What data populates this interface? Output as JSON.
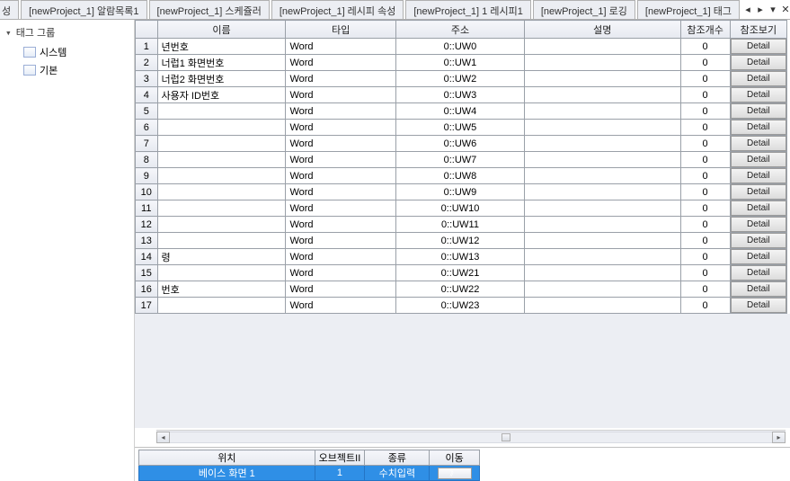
{
  "tabs": {
    "partial_left": "성",
    "items": [
      "[newProject_1] 알람목록1",
      "[newProject_1] 스케쥴러",
      "[newProject_1] 레시피 속성",
      "[newProject_1] 1 레시피1",
      "[newProject_1] 로깅",
      "[newProject_1] 태그"
    ],
    "nav_left": "◂",
    "nav_right": "▸",
    "nav_dropdown": "▾",
    "nav_close": "✕"
  },
  "tree": {
    "title": "태그 그룹",
    "items": [
      "시스템",
      "기본"
    ]
  },
  "grid": {
    "headers": {
      "name": "이름",
      "type": "타입",
      "addr": "주소",
      "desc": "설명",
      "refcnt": "참조개수",
      "refview": "참조보기"
    },
    "detail_label": "Detail",
    "rows": [
      {
        "num": "1",
        "name": "년번호",
        "type": "Word",
        "addr": "0::UW0",
        "desc": "",
        "refcnt": "0"
      },
      {
        "num": "2",
        "name": "너럽1 화면번호",
        "type": "Word",
        "addr": "0::UW1",
        "desc": "",
        "refcnt": "0"
      },
      {
        "num": "3",
        "name": "너럽2 화면번호",
        "type": "Word",
        "addr": "0::UW2",
        "desc": "",
        "refcnt": "0"
      },
      {
        "num": "4",
        "name": "사용자 ID번호",
        "type": "Word",
        "addr": "0::UW3",
        "desc": "",
        "refcnt": "0"
      },
      {
        "num": "5",
        "name": "",
        "type": "Word",
        "addr": "0::UW4",
        "desc": "",
        "refcnt": "0"
      },
      {
        "num": "6",
        "name": "",
        "type": "Word",
        "addr": "0::UW5",
        "desc": "",
        "refcnt": "0"
      },
      {
        "num": "7",
        "name": "",
        "type": "Word",
        "addr": "0::UW6",
        "desc": "",
        "refcnt": "0"
      },
      {
        "num": "8",
        "name": "",
        "type": "Word",
        "addr": "0::UW7",
        "desc": "",
        "refcnt": "0"
      },
      {
        "num": "9",
        "name": "",
        "type": "Word",
        "addr": "0::UW8",
        "desc": "",
        "refcnt": "0"
      },
      {
        "num": "10",
        "name": "",
        "type": "Word",
        "addr": "0::UW9",
        "desc": "",
        "refcnt": "0"
      },
      {
        "num": "11",
        "name": "",
        "type": "Word",
        "addr": "0::UW10",
        "desc": "",
        "refcnt": "0"
      },
      {
        "num": "12",
        "name": "",
        "type": "Word",
        "addr": "0::UW11",
        "desc": "",
        "refcnt": "0"
      },
      {
        "num": "13",
        "name": "",
        "type": "Word",
        "addr": "0::UW12",
        "desc": "",
        "refcnt": "0"
      },
      {
        "num": "14",
        "name": "령",
        "type": "Word",
        "addr": "0::UW13",
        "desc": "",
        "refcnt": "0"
      },
      {
        "num": "15",
        "name": "",
        "type": "Word",
        "addr": "0::UW21",
        "desc": "",
        "refcnt": "0"
      },
      {
        "num": "16",
        "name": "번호",
        "type": "Word",
        "addr": "0::UW22",
        "desc": "",
        "refcnt": "0"
      },
      {
        "num": "17",
        "name": "",
        "type": "Word",
        "addr": "0::UW23",
        "desc": "",
        "refcnt": "0"
      }
    ]
  },
  "bottom": {
    "headers": {
      "loc": "위치",
      "obj": "오브젝트II",
      "kind": "종류",
      "move": "이동"
    },
    "row": {
      "loc": "베이스 화면 1",
      "obj": "1",
      "kind": "수치입력",
      "move": "》"
    }
  }
}
